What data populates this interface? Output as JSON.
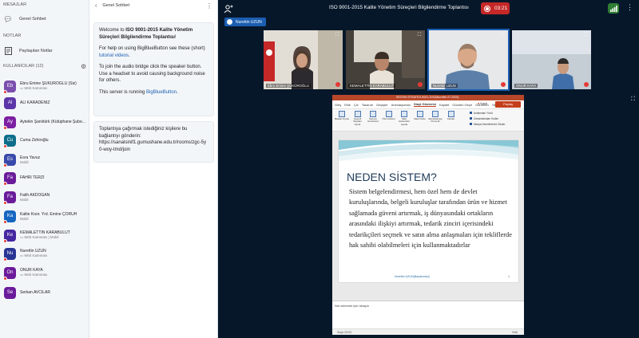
{
  "left": {
    "messages_header": "MESAJLAR",
    "public_chat": "Genel Sohbet",
    "notes_header": "NOTLAR",
    "shared_notes": "Paylaşılan Notlar",
    "users_header": "KULLANICILAR (12)",
    "users": [
      {
        "initials": "Eb",
        "name": "Ebru Emine ŞÜKÜROĞLU (Siz)",
        "status": "▭ Web Kamerası",
        "color": "#7b4fae",
        "dot": true
      },
      {
        "initials": "Al",
        "name": "ALİ KARADENİZ",
        "status": "",
        "color": "#5c35a8",
        "dot": false
      },
      {
        "initials": "Ay",
        "name": "Aytekin Şanlıtürk (Kütüphane Şube...",
        "status": "",
        "color": "#7b1fa2",
        "dot": true
      },
      {
        "initials": "Cu",
        "name": "Cuma Zehiroğlu",
        "status": "",
        "color": "#0d6e8a",
        "dot": true
      },
      {
        "initials": "Es",
        "name": "Esra Yavuz",
        "status": "Mobil",
        "color": "#3949ab",
        "dot": true
      },
      {
        "initials": "Fa",
        "name": "FAHRİ TERZİ",
        "status": "",
        "color": "#6a1b9a",
        "dot": true
      },
      {
        "initials": "Fa",
        "name": "Fatih AKDOĞAN",
        "status": "Mobil",
        "color": "#6a1b9a",
        "dot": true
      },
      {
        "initials": "Ka",
        "name": "Kalite Koor. Yrd. Emine ÇORUH",
        "status": "Mobil",
        "color": "#1565c0",
        "dot": true
      },
      {
        "initials": "Ke",
        "name": "KEMALETTİN KARABULUT",
        "status": "▭ Web Kamerası | Mobil",
        "color": "#4527a0",
        "dot": true
      },
      {
        "initials": "Nu",
        "name": "Nurettin UZUN",
        "status": "▭ Web Kamerası",
        "color": "#283593",
        "dot": true
      },
      {
        "initials": "On",
        "name": "ONUR KAYA",
        "status": "▭ Web Kamerası",
        "color": "#6a1b9a",
        "dot": true
      },
      {
        "initials": "Se",
        "name": "Serkan AVCILAR",
        "status": "",
        "color": "#6a1b9a",
        "dot": false
      }
    ]
  },
  "chat": {
    "header": "Genel Sohbet",
    "welcome_pre": "Welcome to ",
    "welcome_bold": "ISO 9001-2015 Kalite Yönetim Süreçleri Bilgilendirme Toplantısı",
    "welcome_post": "!",
    "help_pre": "For help on using BigBlueButton see these (short) ",
    "help_link": "tutorial videos",
    "help_post": ".",
    "audio": "To join the audio bridge click the speaker button. Use a headset to avoid causing background noise for others.",
    "server_pre": "This server is running ",
    "server_link": "BigBlueButton",
    "server_post": ".",
    "invite_line1": "Toplantıya çağırmak istediğiniz kişilere bu bağlantıyı gönderin:",
    "invite_url": "https://sanalsinif1.gumushane.edu.tr/rooms/zgc-5y0-woy-tmd/join"
  },
  "topbar": {
    "title": "ISO 9001-2015 Kalite Yönetim Süreçleri Bilgilendirme Toplantısı",
    "timer": "03:21",
    "presenter": "Nurettin UZUN"
  },
  "videos": [
    {
      "name": "Ebru Emine ŞÜKÜROĞLU",
      "bg": "#d8d4cc"
    },
    {
      "name": "KEMALETTİN KARABULUT",
      "bg": "#3a3733"
    },
    {
      "name": "Nurettin UZUN",
      "bg": "#e8eaec"
    },
    {
      "name": "ONUR KAYA",
      "bg": "#cfd8e0"
    }
  ],
  "ppt": {
    "file_title": "SİSTEM STRATEJİ-9001-2015(Nurettin 07.2025)",
    "tabs": [
      "Giriş",
      "Ekle",
      "Çiz",
      "Tasarım",
      "Geçişler",
      "Animasyonlar",
      "Slayt Gösterisi",
      "Kaydet",
      "Gözden Geçir",
      "Görünüm",
      "Yardım"
    ],
    "active_tab": "Slayt Gösterisi",
    "share": "Paylaş",
    "record": "Kayıt",
    "ribbon": [
      "Baştan Oynat",
      "Geçerli Slayttan Oynat",
      "Sunucu Görünümü",
      "Özel Gösteri",
      "Slayt Gösterisini Ayarla",
      "Slaytı Gizle",
      "Zamanlamayı Prova Et",
      "Kaydet"
    ],
    "checks": [
      "Anlatımları Yürüt",
      "Zamanlamaları Kullan",
      "Medya Denetimlerini Göster"
    ],
    "slide_title": "NEDEN SİSTEM?",
    "slide_body": "Sistem belgelendirmesi, hem özel hem de devlet kuruluşlarında, belgeli kuruluşlar tarafından ürün ve hizmet sağlamada güveni artırmak, iş dünyasındaki ortakların arasındaki ilişkiyi artırmak, tedarik zinciri içerisindeki tedarikçileri seçmek ve satın alma anlaşmaları için tekliflerde hak sahibi olabilmeleri için kullanmaktadırlar",
    "slide_footer": "Nurettin UZUN(Başdenetçi)",
    "slide_num": "1",
    "notes_placeholder": "Not eklemek için tıklayın",
    "status_left": "Slayt 32/33",
    "zoom": "%68"
  }
}
